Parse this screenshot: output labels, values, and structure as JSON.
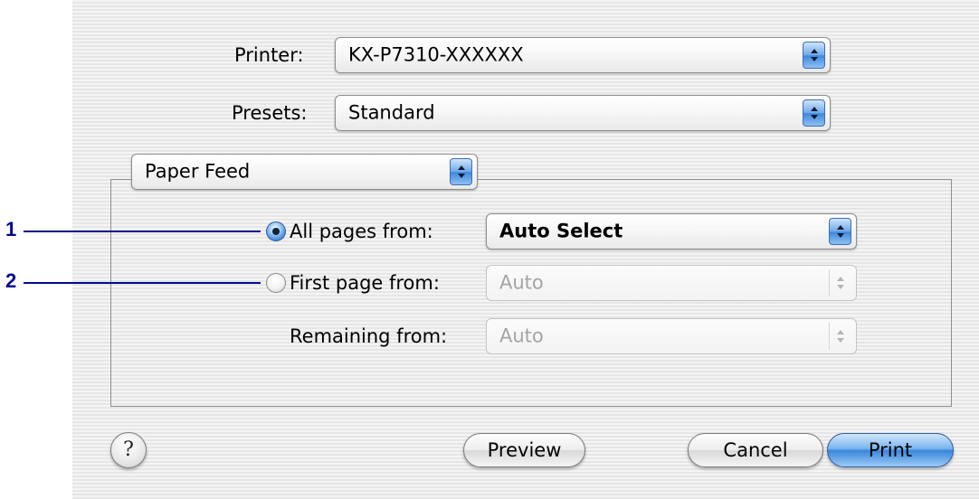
{
  "printer": {
    "label": "Printer:",
    "value": "KX-P7310-XXXXXX"
  },
  "presets": {
    "label": "Presets:",
    "value": "Standard"
  },
  "panel_menu": {
    "value": "Paper Feed"
  },
  "paper_feed": {
    "all_pages": {
      "label": "All pages from:",
      "value": "Auto Select",
      "selected": true
    },
    "first_page": {
      "label": "First page from:",
      "value": "Auto",
      "selected": false
    },
    "remaining": {
      "label": "Remaining from:",
      "value": "Auto"
    }
  },
  "callouts": [
    {
      "number": "1"
    },
    {
      "number": "2"
    }
  ],
  "buttons": {
    "help": "?",
    "preview": "Preview",
    "cancel": "Cancel",
    "print": "Print"
  },
  "icons": {
    "popup_arrow": "up-down-arrows-icon",
    "help": "question-mark-icon"
  },
  "colors": {
    "callout": "#000c8c",
    "accent": "#3a86da"
  }
}
